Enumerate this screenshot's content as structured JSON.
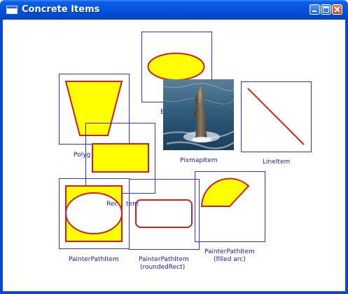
{
  "window": {
    "title": "Concrete Items",
    "title_icon": "app-window-icon",
    "buttons": {
      "minimize_icon": "minimize-icon",
      "maximize_icon": "maximize-icon",
      "close_icon": "close-icon"
    }
  },
  "colors": {
    "item_border": "#3535d0",
    "shape_stroke": "#d21f1f",
    "shape_fill": "#ffff00",
    "label_text": "#1c1ca8",
    "titlebar": "#0454dd"
  },
  "items": {
    "ellipse": {
      "label_partial": "E"
    },
    "polygon": {
      "label_partial": "Polyg"
    },
    "rect": {
      "label_partial": "Rec",
      "label_partial_tail": "tem"
    },
    "pixmap": {
      "label": "PixmapItem",
      "image": "sea-stack-photo"
    },
    "line": {
      "label": "LineItem"
    },
    "painter_path": {
      "label": "PainterPathItem"
    },
    "rounded_rect": {
      "label_line1": "PainterPathItem",
      "label_line2": "(roundedRect)"
    },
    "filled_arc": {
      "label_line1": "PainterPathItem",
      "label_line2": "(filled arc)"
    }
  }
}
